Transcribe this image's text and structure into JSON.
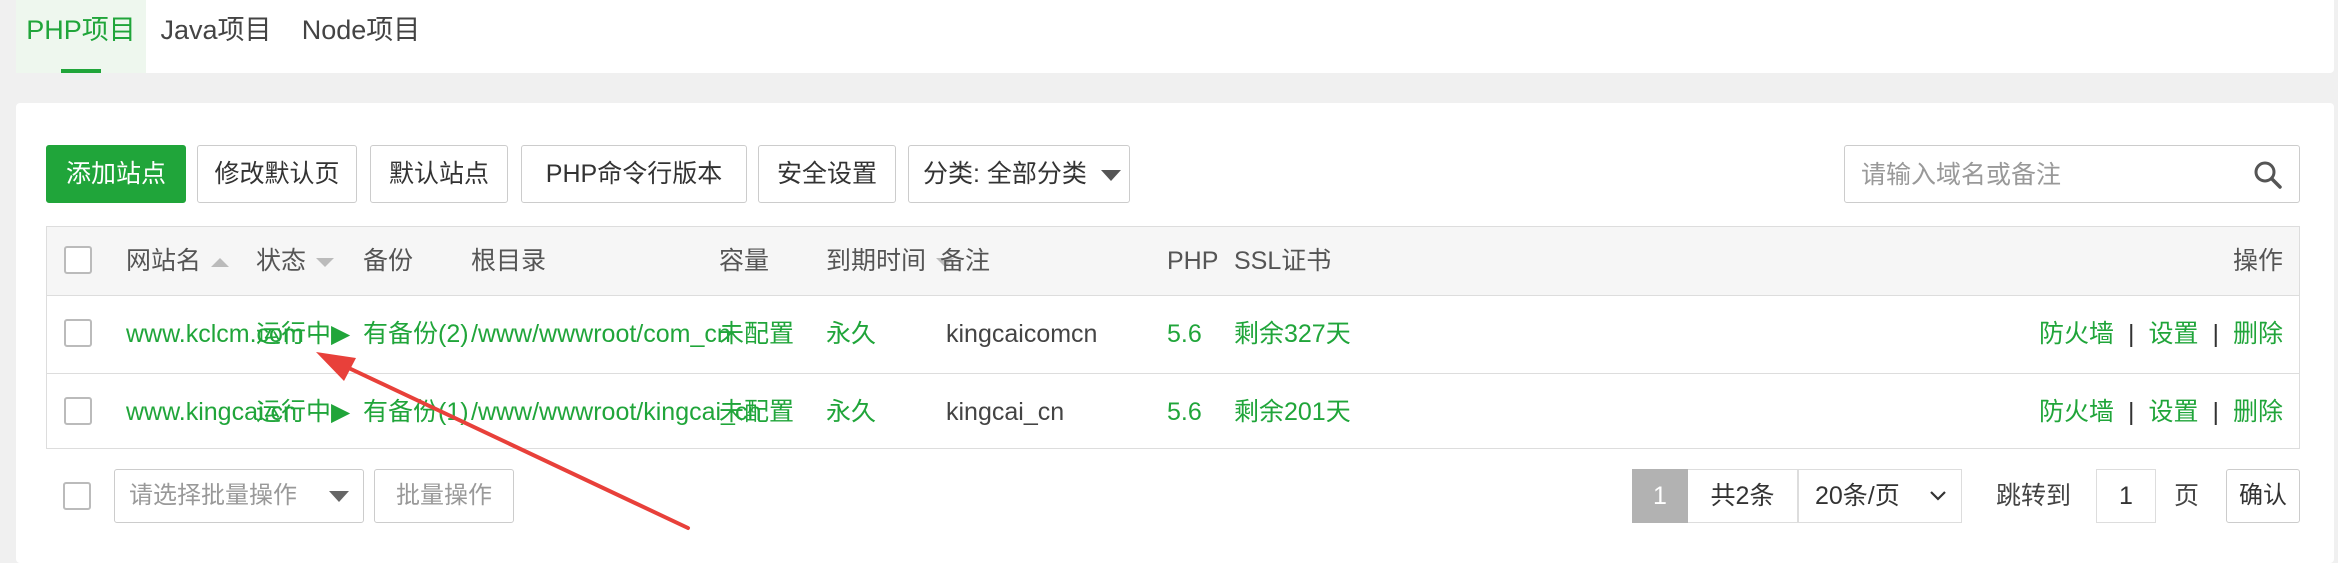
{
  "tabs": [
    {
      "label": "PHP项目",
      "active": true
    },
    {
      "label": "Java项目",
      "active": false
    },
    {
      "label": "Node项目",
      "active": false
    }
  ],
  "toolbar": {
    "add_site": "添加站点",
    "modify_default_page": "修改默认页",
    "default_site": "默认站点",
    "php_cli_version": "PHP命令行版本",
    "security_settings": "安全设置",
    "category": "分类: 全部分类"
  },
  "search": {
    "placeholder": "请输入域名或备注"
  },
  "table": {
    "headers": {
      "site_name": "网站名",
      "status": "状态",
      "backup": "备份",
      "root_dir": "根目录",
      "capacity": "容量",
      "expire": "到期时间",
      "remark": "备注",
      "php": "PHP",
      "ssl": "SSL证书",
      "actions": "操作"
    },
    "rows": [
      {
        "site": "www.kclcm.com",
        "status": "运行中▶",
        "backup": "有备份(2)",
        "root": "/www/wwwroot/com_cn",
        "capacity": "未配置",
        "expire": "永久",
        "remark": "kingcaicomcn",
        "php": "5.6",
        "ssl": "剩余327天",
        "firewall": "防火墙",
        "settings": "设置",
        "delete": "删除"
      },
      {
        "site": "www.kingcai.cn",
        "status": "运行中▶",
        "backup": "有备份(1)",
        "root": "/www/wwwroot/kingcai_cn",
        "capacity": "未配置",
        "expire": "永久",
        "remark": "kingcai_cn",
        "php": "5.6",
        "ssl": "剩余201天",
        "firewall": "防火墙",
        "settings": "设置",
        "delete": "删除"
      }
    ],
    "separator": "|"
  },
  "footer": {
    "batch_placeholder": "请选择批量操作",
    "batch_button": "批量操作",
    "current_page": "1",
    "total": "共2条",
    "page_size": "20条/页",
    "jump_to": "跳转到",
    "jump_value": "1",
    "page_unit": "页",
    "confirm": "确认"
  },
  "colors": {
    "accent": "#20a53a",
    "annotation_arrow": "#e8403a"
  }
}
